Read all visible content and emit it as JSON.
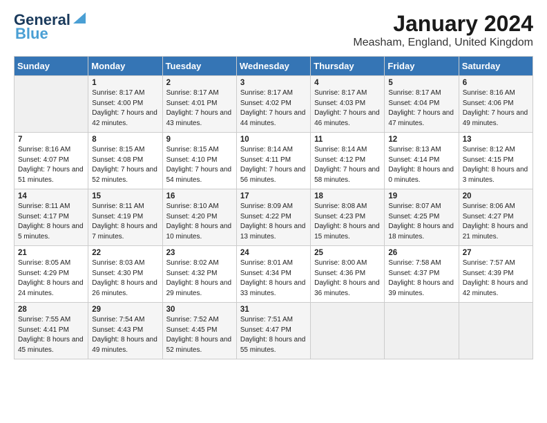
{
  "logo": {
    "line1": "General",
    "line2": "Blue"
  },
  "header": {
    "month_year": "January 2024",
    "location": "Measham, England, United Kingdom"
  },
  "days_of_week": [
    "Sunday",
    "Monday",
    "Tuesday",
    "Wednesday",
    "Thursday",
    "Friday",
    "Saturday"
  ],
  "weeks": [
    [
      {
        "day": "",
        "sunrise": "",
        "sunset": "",
        "daylight": ""
      },
      {
        "day": "1",
        "sunrise": "Sunrise: 8:17 AM",
        "sunset": "Sunset: 4:00 PM",
        "daylight": "Daylight: 7 hours and 42 minutes."
      },
      {
        "day": "2",
        "sunrise": "Sunrise: 8:17 AM",
        "sunset": "Sunset: 4:01 PM",
        "daylight": "Daylight: 7 hours and 43 minutes."
      },
      {
        "day": "3",
        "sunrise": "Sunrise: 8:17 AM",
        "sunset": "Sunset: 4:02 PM",
        "daylight": "Daylight: 7 hours and 44 minutes."
      },
      {
        "day": "4",
        "sunrise": "Sunrise: 8:17 AM",
        "sunset": "Sunset: 4:03 PM",
        "daylight": "Daylight: 7 hours and 46 minutes."
      },
      {
        "day": "5",
        "sunrise": "Sunrise: 8:17 AM",
        "sunset": "Sunset: 4:04 PM",
        "daylight": "Daylight: 7 hours and 47 minutes."
      },
      {
        "day": "6",
        "sunrise": "Sunrise: 8:16 AM",
        "sunset": "Sunset: 4:06 PM",
        "daylight": "Daylight: 7 hours and 49 minutes."
      }
    ],
    [
      {
        "day": "7",
        "sunrise": "Sunrise: 8:16 AM",
        "sunset": "Sunset: 4:07 PM",
        "daylight": "Daylight: 7 hours and 51 minutes."
      },
      {
        "day": "8",
        "sunrise": "Sunrise: 8:15 AM",
        "sunset": "Sunset: 4:08 PM",
        "daylight": "Daylight: 7 hours and 52 minutes."
      },
      {
        "day": "9",
        "sunrise": "Sunrise: 8:15 AM",
        "sunset": "Sunset: 4:10 PM",
        "daylight": "Daylight: 7 hours and 54 minutes."
      },
      {
        "day": "10",
        "sunrise": "Sunrise: 8:14 AM",
        "sunset": "Sunset: 4:11 PM",
        "daylight": "Daylight: 7 hours and 56 minutes."
      },
      {
        "day": "11",
        "sunrise": "Sunrise: 8:14 AM",
        "sunset": "Sunset: 4:12 PM",
        "daylight": "Daylight: 7 hours and 58 minutes."
      },
      {
        "day": "12",
        "sunrise": "Sunrise: 8:13 AM",
        "sunset": "Sunset: 4:14 PM",
        "daylight": "Daylight: 8 hours and 0 minutes."
      },
      {
        "day": "13",
        "sunrise": "Sunrise: 8:12 AM",
        "sunset": "Sunset: 4:15 PM",
        "daylight": "Daylight: 8 hours and 3 minutes."
      }
    ],
    [
      {
        "day": "14",
        "sunrise": "Sunrise: 8:11 AM",
        "sunset": "Sunset: 4:17 PM",
        "daylight": "Daylight: 8 hours and 5 minutes."
      },
      {
        "day": "15",
        "sunrise": "Sunrise: 8:11 AM",
        "sunset": "Sunset: 4:19 PM",
        "daylight": "Daylight: 8 hours and 7 minutes."
      },
      {
        "day": "16",
        "sunrise": "Sunrise: 8:10 AM",
        "sunset": "Sunset: 4:20 PM",
        "daylight": "Daylight: 8 hours and 10 minutes."
      },
      {
        "day": "17",
        "sunrise": "Sunrise: 8:09 AM",
        "sunset": "Sunset: 4:22 PM",
        "daylight": "Daylight: 8 hours and 13 minutes."
      },
      {
        "day": "18",
        "sunrise": "Sunrise: 8:08 AM",
        "sunset": "Sunset: 4:23 PM",
        "daylight": "Daylight: 8 hours and 15 minutes."
      },
      {
        "day": "19",
        "sunrise": "Sunrise: 8:07 AM",
        "sunset": "Sunset: 4:25 PM",
        "daylight": "Daylight: 8 hours and 18 minutes."
      },
      {
        "day": "20",
        "sunrise": "Sunrise: 8:06 AM",
        "sunset": "Sunset: 4:27 PM",
        "daylight": "Daylight: 8 hours and 21 minutes."
      }
    ],
    [
      {
        "day": "21",
        "sunrise": "Sunrise: 8:05 AM",
        "sunset": "Sunset: 4:29 PM",
        "daylight": "Daylight: 8 hours and 24 minutes."
      },
      {
        "day": "22",
        "sunrise": "Sunrise: 8:03 AM",
        "sunset": "Sunset: 4:30 PM",
        "daylight": "Daylight: 8 hours and 26 minutes."
      },
      {
        "day": "23",
        "sunrise": "Sunrise: 8:02 AM",
        "sunset": "Sunset: 4:32 PM",
        "daylight": "Daylight: 8 hours and 29 minutes."
      },
      {
        "day": "24",
        "sunrise": "Sunrise: 8:01 AM",
        "sunset": "Sunset: 4:34 PM",
        "daylight": "Daylight: 8 hours and 33 minutes."
      },
      {
        "day": "25",
        "sunrise": "Sunrise: 8:00 AM",
        "sunset": "Sunset: 4:36 PM",
        "daylight": "Daylight: 8 hours and 36 minutes."
      },
      {
        "day": "26",
        "sunrise": "Sunrise: 7:58 AM",
        "sunset": "Sunset: 4:37 PM",
        "daylight": "Daylight: 8 hours and 39 minutes."
      },
      {
        "day": "27",
        "sunrise": "Sunrise: 7:57 AM",
        "sunset": "Sunset: 4:39 PM",
        "daylight": "Daylight: 8 hours and 42 minutes."
      }
    ],
    [
      {
        "day": "28",
        "sunrise": "Sunrise: 7:55 AM",
        "sunset": "Sunset: 4:41 PM",
        "daylight": "Daylight: 8 hours and 45 minutes."
      },
      {
        "day": "29",
        "sunrise": "Sunrise: 7:54 AM",
        "sunset": "Sunset: 4:43 PM",
        "daylight": "Daylight: 8 hours and 49 minutes."
      },
      {
        "day": "30",
        "sunrise": "Sunrise: 7:52 AM",
        "sunset": "Sunset: 4:45 PM",
        "daylight": "Daylight: 8 hours and 52 minutes."
      },
      {
        "day": "31",
        "sunrise": "Sunrise: 7:51 AM",
        "sunset": "Sunset: 4:47 PM",
        "daylight": "Daylight: 8 hours and 55 minutes."
      },
      {
        "day": "",
        "sunrise": "",
        "sunset": "",
        "daylight": ""
      },
      {
        "day": "",
        "sunrise": "",
        "sunset": "",
        "daylight": ""
      },
      {
        "day": "",
        "sunrise": "",
        "sunset": "",
        "daylight": ""
      }
    ]
  ]
}
